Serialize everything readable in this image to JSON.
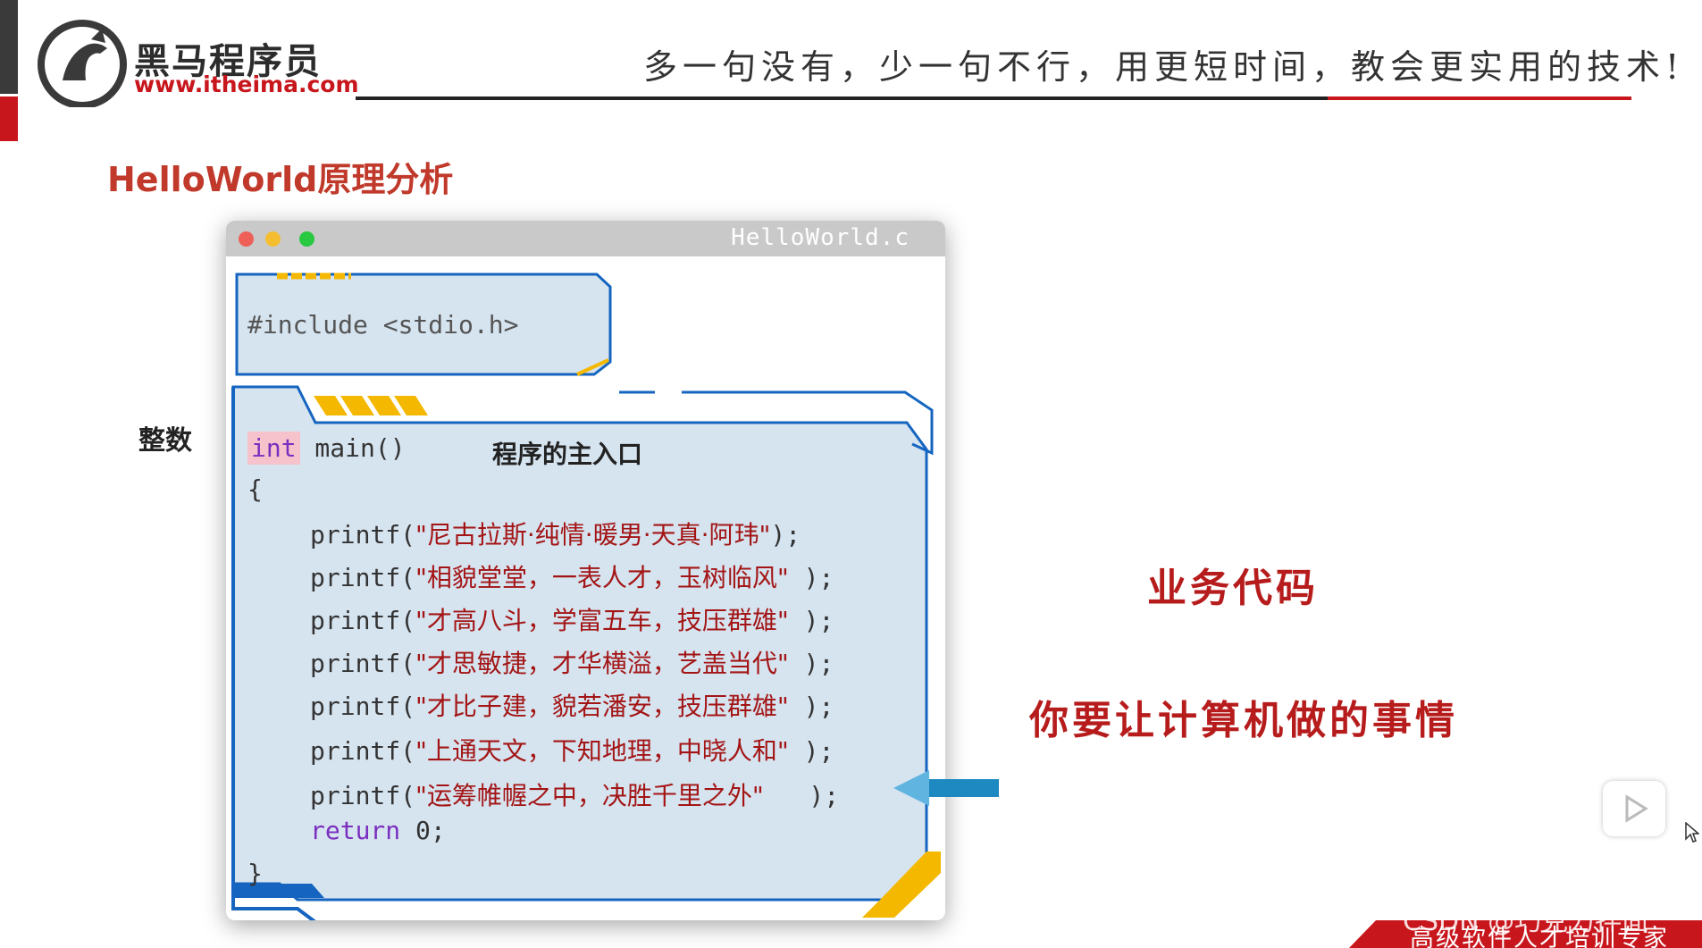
{
  "header": {
    "brand_cn": "黑马程序员",
    "brand_url": "www.itheima.com",
    "slogan": "多一句没有，少一句不行，用更短时间，教会更实用的技术!"
  },
  "section_title": "HelloWorld原理分析",
  "editor": {
    "filename": "HelloWorld.c",
    "include_line": "#include <stdio.h>",
    "kw_int": "int",
    "main_sig": " main()",
    "main_comment": "程序的主入口",
    "open_brace": "{",
    "printf_prefix": "printf(",
    "lines": [
      "\"尼古拉斯·纯情·暖男·天真·阿玮\"",
      "\"相貌堂堂，一表人才，玉树临风\"",
      "\"才高八斗，学富五车，技压群雄\"",
      "\"才思敏捷，才华横溢，艺盖当代\"",
      "\"才比子建，貌若潘安，技压群雄\"",
      "\"上通天文，下知地理，中晓人和\"",
      "\"运筹帷幄之中，决胜千里之外\""
    ],
    "printf_suffix_first": ");",
    "printf_suffix": " );",
    "printf_suffix_last": "   );",
    "kw_return": "return",
    "return_value": " 0;",
    "close_brace": "}"
  },
  "annotations": {
    "integer_label": "整数",
    "business_code": "业务代码",
    "computer_task": "你要让计算机做的事情"
  },
  "footer": {
    "tagline": "高级软件人才培训专家",
    "watermark": "CSDN @巧克力拌面"
  },
  "colors": {
    "brand_red": "#c8161d",
    "code_bg": "#d6e4f0",
    "frame_blue": "#1565c0",
    "accent_yellow": "#f5b800"
  }
}
